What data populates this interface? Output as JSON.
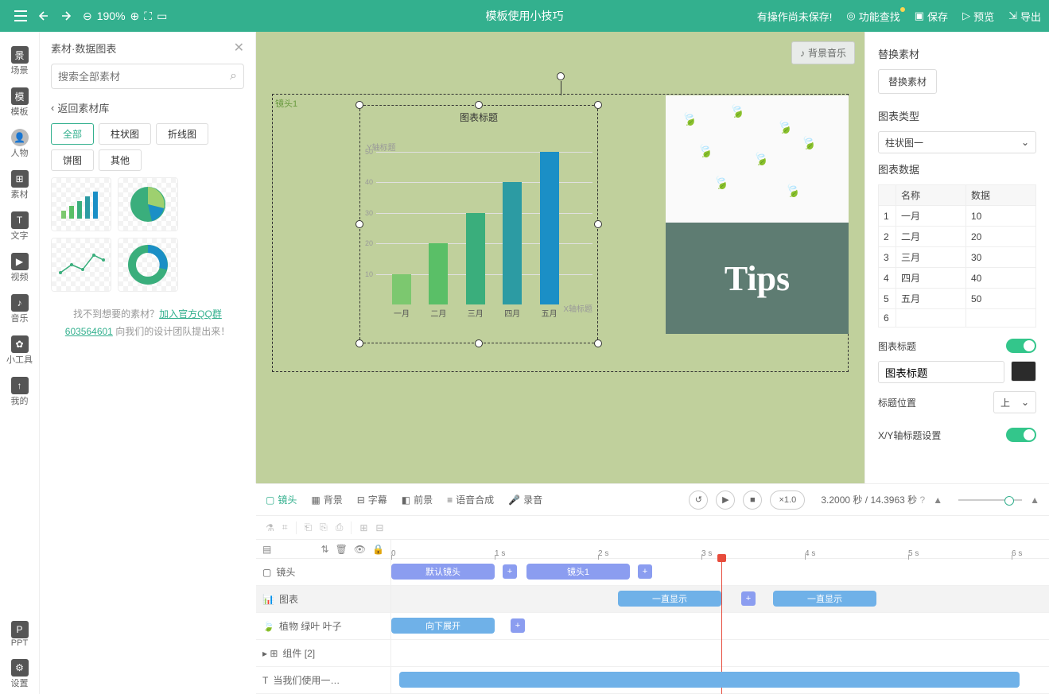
{
  "topbar": {
    "zoom": "190%",
    "title": "模板使用小技巧",
    "unsaved": "有操作尚未保存!",
    "find": "功能查找",
    "save": "保存",
    "preview": "预览",
    "export": "导出"
  },
  "leftrail": {
    "scene": "场景",
    "template": "模板",
    "person": "人物",
    "asset": "素材",
    "text": "文字",
    "video": "视频",
    "music": "音乐",
    "tool": "小工具",
    "mine": "我的",
    "ppt": "PPT",
    "settings": "设置"
  },
  "assets": {
    "title": "素材·数据图表",
    "search_placeholder": "搜索全部素材",
    "back": "返回素材库",
    "tabs": {
      "all": "全部",
      "bar": "柱状图",
      "line": "折线图",
      "pie": "饼图",
      "other": "其他"
    },
    "help_prefix": "找不到想要的素材？",
    "help_link": "加入官方QQ群 603564601",
    "help_suffix": " 向我们的设计团队提出来！"
  },
  "canvas": {
    "bgmusic": "背景音乐",
    "shot_label": "镜头1",
    "chart_title": "图表标题",
    "ylabel": "Y轴标题",
    "xlabel": "X轴标题",
    "tips": "Tips"
  },
  "rightpanel": {
    "replace_h": "替换素材",
    "replace_btn": "替换素材",
    "type_h": "图表类型",
    "type_val": "柱状图一",
    "data_h": "图表数据",
    "th_name": "名称",
    "th_val": "数据",
    "rows": [
      {
        "i": "1",
        "name": "一月",
        "val": "10"
      },
      {
        "i": "2",
        "name": "二月",
        "val": "20"
      },
      {
        "i": "3",
        "name": "三月",
        "val": "30"
      },
      {
        "i": "4",
        "name": "四月",
        "val": "40"
      },
      {
        "i": "5",
        "name": "五月",
        "val": "50"
      },
      {
        "i": "6",
        "name": "",
        "val": ""
      }
    ],
    "title_h": "图表标题",
    "title_val": "图表标题",
    "pos_h": "标题位置",
    "pos_val": "上",
    "axis_h": "X/Y轴标题设置"
  },
  "timeline": {
    "tabs": {
      "shot": "镜头",
      "bg": "背景",
      "subtitle": "字幕",
      "fg": "前景",
      "tts": "语音合成",
      "rec": "录音"
    },
    "speed": "×1.0",
    "cur": "3.2000",
    "total": "14.3963",
    "sec": "秒",
    "ticks": [
      "0",
      "1 s",
      "2 s",
      "3 s",
      "4 s",
      "5 s",
      "6 s"
    ],
    "rows": {
      "shot": "镜头",
      "chart": "图表",
      "leaf": "植物 绿叶 叶子",
      "group": "组件 [2]",
      "text": "当我们使用一…"
    },
    "clips": {
      "default_shot": "默认镜头",
      "shot1": "镜头1",
      "always": "一直显示",
      "down": "向下展开"
    }
  },
  "chart_data": {
    "type": "bar",
    "title": "图表标题",
    "xlabel": "X轴标题",
    "ylabel": "Y轴标题",
    "ylim": [
      0,
      50
    ],
    "yticks": [
      10,
      20,
      30,
      40,
      50
    ],
    "categories": [
      "一月",
      "二月",
      "三月",
      "四月",
      "五月"
    ],
    "values": [
      10,
      20,
      30,
      40,
      50
    ],
    "colors": [
      "#7cc86f",
      "#5abf67",
      "#3aae7c",
      "#2c9ba3",
      "#1b8fc6"
    ]
  }
}
